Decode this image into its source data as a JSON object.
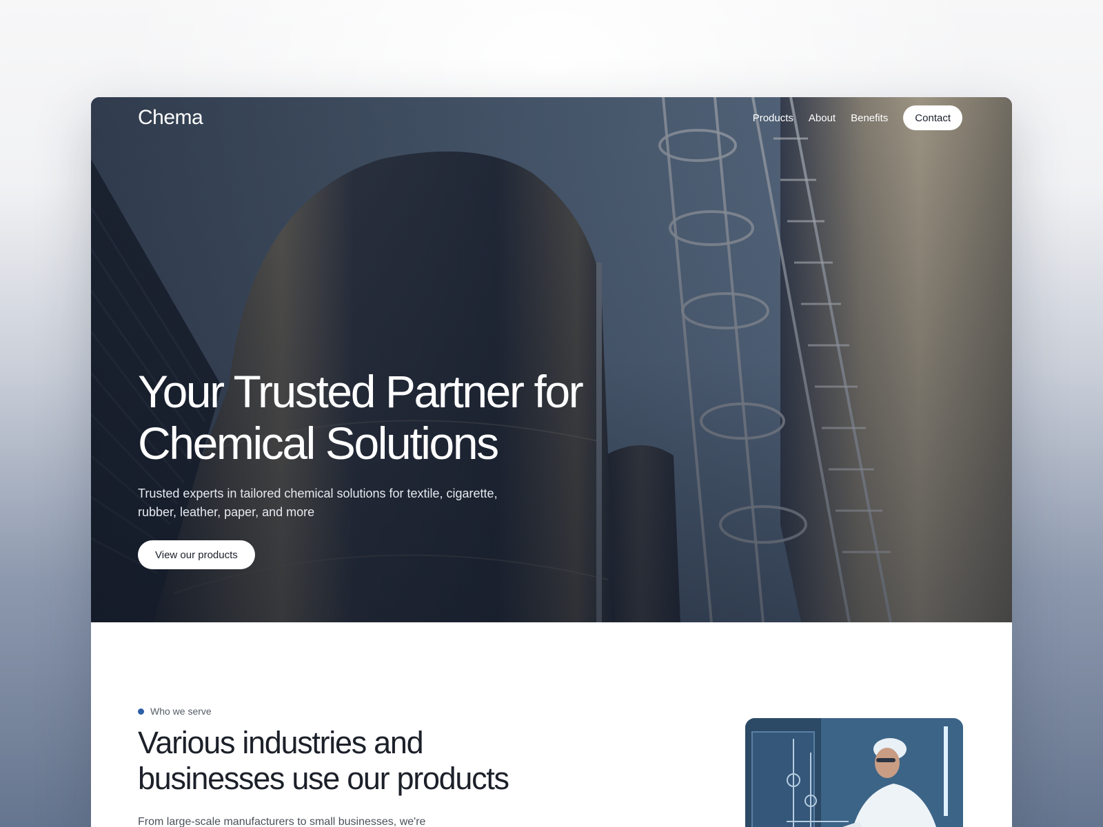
{
  "brand": {
    "logo": "Chema"
  },
  "nav": {
    "links": [
      "Products",
      "About",
      "Benefits"
    ],
    "contact_label": "Contact"
  },
  "hero": {
    "title_line1": "Your Trusted Partner for",
    "title_line2": "Chemical Solutions",
    "subtitle_line1": "Trusted experts in tailored chemical solutions for textile, cigarette,",
    "subtitle_line2": "rubber, leather, paper, and more",
    "cta_label": "View our products"
  },
  "serve": {
    "eyebrow": "Who we serve",
    "title_line1": "Various industries and",
    "title_line2": "businesses use our products",
    "text": "From large-scale manufacturers to small businesses, we're"
  },
  "colors": {
    "accent_dot": "#2d5fa6",
    "hero_sky": "#5d7087",
    "text_dark": "#1c2029"
  }
}
